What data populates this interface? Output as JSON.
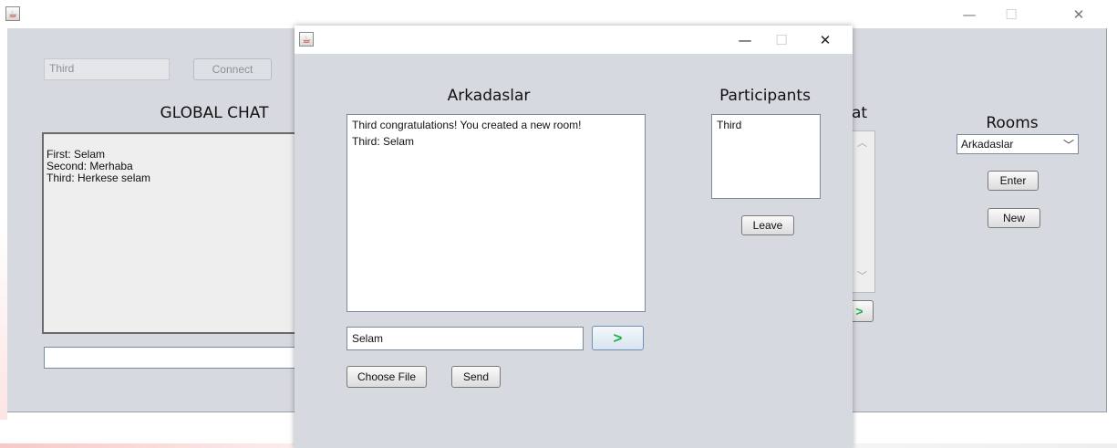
{
  "main_window": {
    "username_field": "Third",
    "connect_label": "Connect",
    "global_chat_title": "GLOBAL CHAT",
    "global_messages": [
      "First: Selam",
      "Second: Merhaba",
      "Third: Herkese selam"
    ],
    "global_input": "",
    "partial_heading": "at",
    "rooms_title": "Rooms",
    "rooms_selected": "Arkadaslar",
    "enter_label": "Enter",
    "new_label": "New",
    "send_arrow": ">",
    "window_controls": {
      "minimize": "—",
      "maximize": "☐",
      "close": "✕"
    }
  },
  "room_window": {
    "room_title": "Arkadaslar",
    "messages": [
      "Third congratulations! You created a new room!",
      "Third: Selam"
    ],
    "participants_title": "Participants",
    "participants": [
      "Third"
    ],
    "leave_label": "Leave",
    "message_input": "Selam",
    "send_arrow": ">",
    "choose_file_label": "Choose File",
    "send_label": "Send",
    "window_controls": {
      "minimize": "—",
      "maximize": "☐",
      "close": "✕"
    }
  },
  "colors": {
    "panel_bg": "#d6d9df",
    "send_arrow": "#22b14c",
    "border_accent": "#e8484d"
  }
}
